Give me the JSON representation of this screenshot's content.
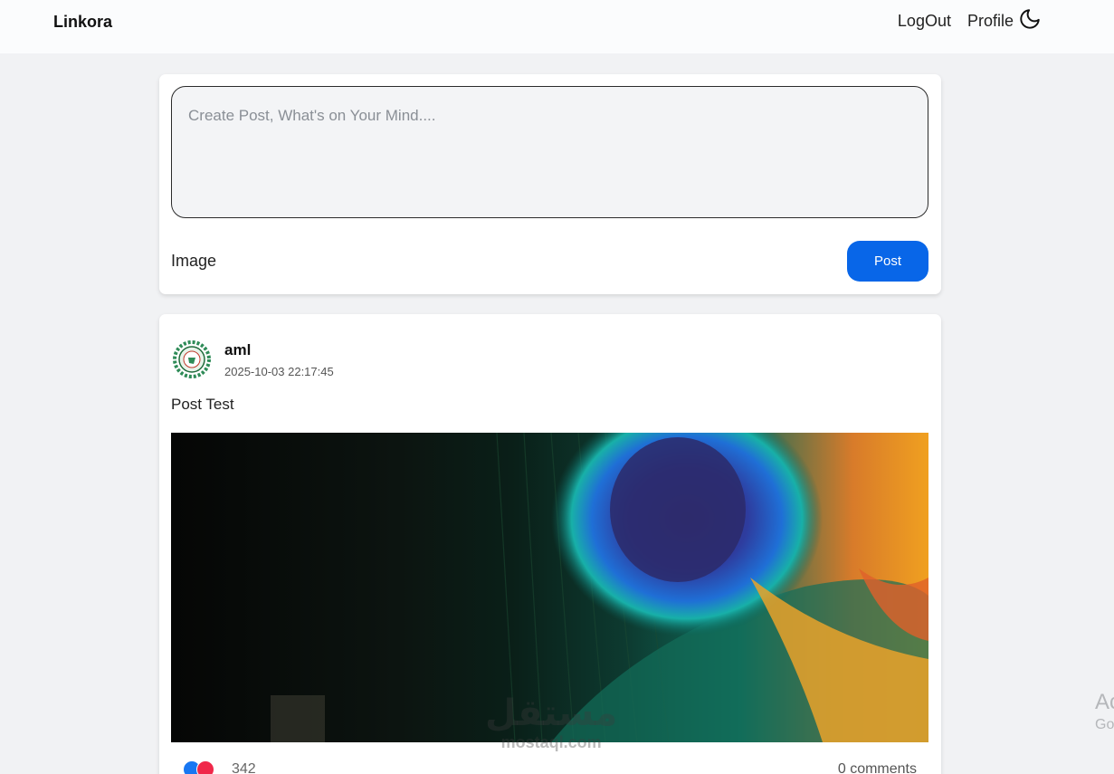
{
  "nav": {
    "brand": "Linkora",
    "logout": "LogOut",
    "profile": "Profile",
    "theme_icon": "moon-icon"
  },
  "composer": {
    "placeholder": "Create Post, What's on Your Mind....",
    "value": "",
    "image_label": "Image",
    "post_label": "Post"
  },
  "post": {
    "author": "aml",
    "timestamp": "2025-10-03 22:17:45",
    "text": "Post Test",
    "reaction_count": "342",
    "comments": "0 comments"
  },
  "watermark": {
    "arabic": "مستقل",
    "latin": "mostaql.com"
  },
  "system_overlay": {
    "line1": "Ac",
    "line2": "Go"
  },
  "colors": {
    "primary": "#0866e8",
    "background": "#f1f2f4",
    "like": "#1877f2",
    "love": "#f0284a"
  }
}
